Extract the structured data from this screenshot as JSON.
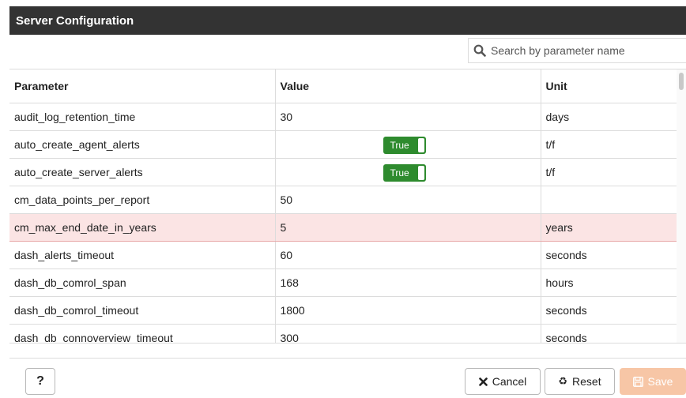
{
  "dialog": {
    "title": "Server Configuration"
  },
  "search": {
    "placeholder": "Search by parameter name"
  },
  "table": {
    "headers": {
      "parameter": "Parameter",
      "value": "Value",
      "unit": "Unit"
    },
    "rows": [
      {
        "parameter": "audit_log_retention_time",
        "value": "30",
        "unit": "days"
      },
      {
        "parameter": "auto_create_agent_alerts",
        "value": "True",
        "unit": "t/f"
      },
      {
        "parameter": "auto_create_server_alerts",
        "value": "True",
        "unit": "t/f"
      },
      {
        "parameter": "cm_data_points_per_report",
        "value": "50",
        "unit": ""
      },
      {
        "parameter": "cm_max_end_date_in_years",
        "value": "5",
        "unit": "years"
      },
      {
        "parameter": "dash_alerts_timeout",
        "value": "60",
        "unit": "seconds"
      },
      {
        "parameter": "dash_db_comrol_span",
        "value": "168",
        "unit": "hours"
      },
      {
        "parameter": "dash_db_comrol_timeout",
        "value": "1800",
        "unit": "seconds"
      },
      {
        "parameter": "dash_db_connoverview_timeout",
        "value": "300",
        "unit": "seconds"
      }
    ]
  },
  "footer": {
    "help_label": "?",
    "cancel_label": "Cancel",
    "reset_label": "Reset",
    "save_label": "Save"
  },
  "colors": {
    "toggle_on": "#2e8b2e",
    "highlight_row": "#fbe4e4",
    "save_disabled": "#f7c6a6",
    "titlebar": "#333333"
  }
}
